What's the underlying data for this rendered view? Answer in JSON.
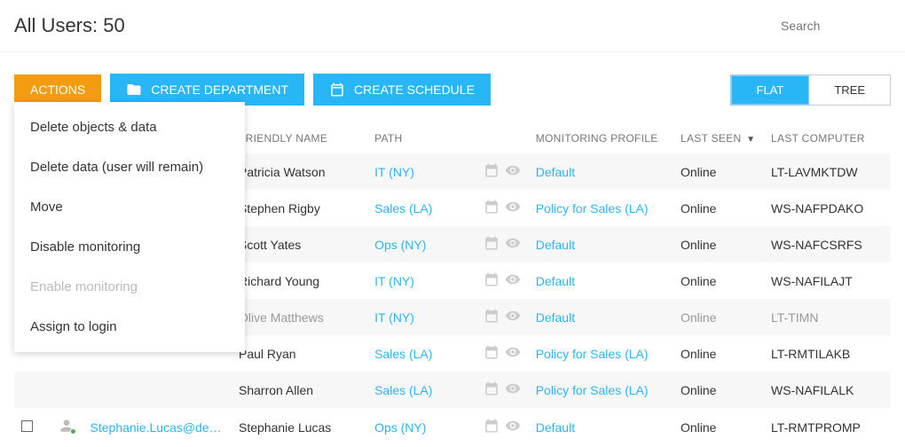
{
  "header": {
    "title": "All Users: 50",
    "search_placeholder": "Search"
  },
  "toolbar": {
    "actions": "ACTIONS",
    "create_department": "CREATE DEPARTMENT",
    "create_schedule": "CREATE SCHEDULE",
    "view_flat": "FLAT",
    "view_tree": "TREE"
  },
  "actions_menu": [
    {
      "label": "Delete objects & data",
      "disabled": false
    },
    {
      "label": "Delete data (user will remain)",
      "disabled": false
    },
    {
      "label": "Move",
      "disabled": false
    },
    {
      "label": "Disable monitoring",
      "disabled": false
    },
    {
      "label": "Enable monitoring",
      "disabled": true
    },
    {
      "label": "Assign to login",
      "disabled": false
    }
  ],
  "columns": {
    "friendly": "FRIENDLY NAME",
    "path": "PATH",
    "profile": "MONITORING PROFILE",
    "lastseen": "LAST SEEN",
    "lastcomp": "LAST COMPUTER"
  },
  "rows": [
    {
      "login": "",
      "friendly": "Patricia Watson",
      "path": "IT (NY)",
      "profile": "Default",
      "lastseen": "Online",
      "lastcomp": "LT-LAVMKTDW",
      "gray": false,
      "login_visible": false
    },
    {
      "login": "",
      "friendly": "Stephen Rigby",
      "path": "Sales (LA)",
      "profile": "Policy for Sales (LA)",
      "lastseen": "Online",
      "lastcomp": "WS-NAFPDAKO",
      "gray": false,
      "login_visible": false
    },
    {
      "login": "",
      "friendly": "Scott Yates",
      "path": "Ops (NY)",
      "profile": "Default",
      "lastseen": "Online",
      "lastcomp": "WS-NAFCSRFS",
      "gray": false,
      "login_visible": false
    },
    {
      "login": "",
      "friendly": "Richard Young",
      "path": "IT (NY)",
      "profile": "Default",
      "lastseen": "Online",
      "lastcomp": "WS-NAFILAJT",
      "gray": false,
      "login_visible": false
    },
    {
      "login": "",
      "friendly": "Olive Matthews",
      "path": "IT (NY)",
      "profile": "Default",
      "lastseen": "Online",
      "lastcomp": "LT-TIMN",
      "gray": true,
      "login_visible": false
    },
    {
      "login": "",
      "friendly": "Paul Ryan",
      "path": "Sales (LA)",
      "profile": "Policy for Sales (LA)",
      "lastseen": "Online",
      "lastcomp": "LT-RMTILAKB",
      "gray": false,
      "login_visible": false
    },
    {
      "login": "",
      "friendly": "Sharron Allen",
      "path": "Sales (LA)",
      "profile": "Policy for Sales (LA)",
      "lastseen": "Online",
      "lastcomp": "WS-NAFILALK",
      "gray": false,
      "login_visible": false
    },
    {
      "login": "Stephanie.Lucas@de…",
      "friendly": "Stephanie Lucas",
      "path": "Ops (NY)",
      "profile": "Default",
      "lastseen": "Online",
      "lastcomp": "LT-RMTPROMP",
      "gray": false,
      "login_visible": true
    }
  ]
}
